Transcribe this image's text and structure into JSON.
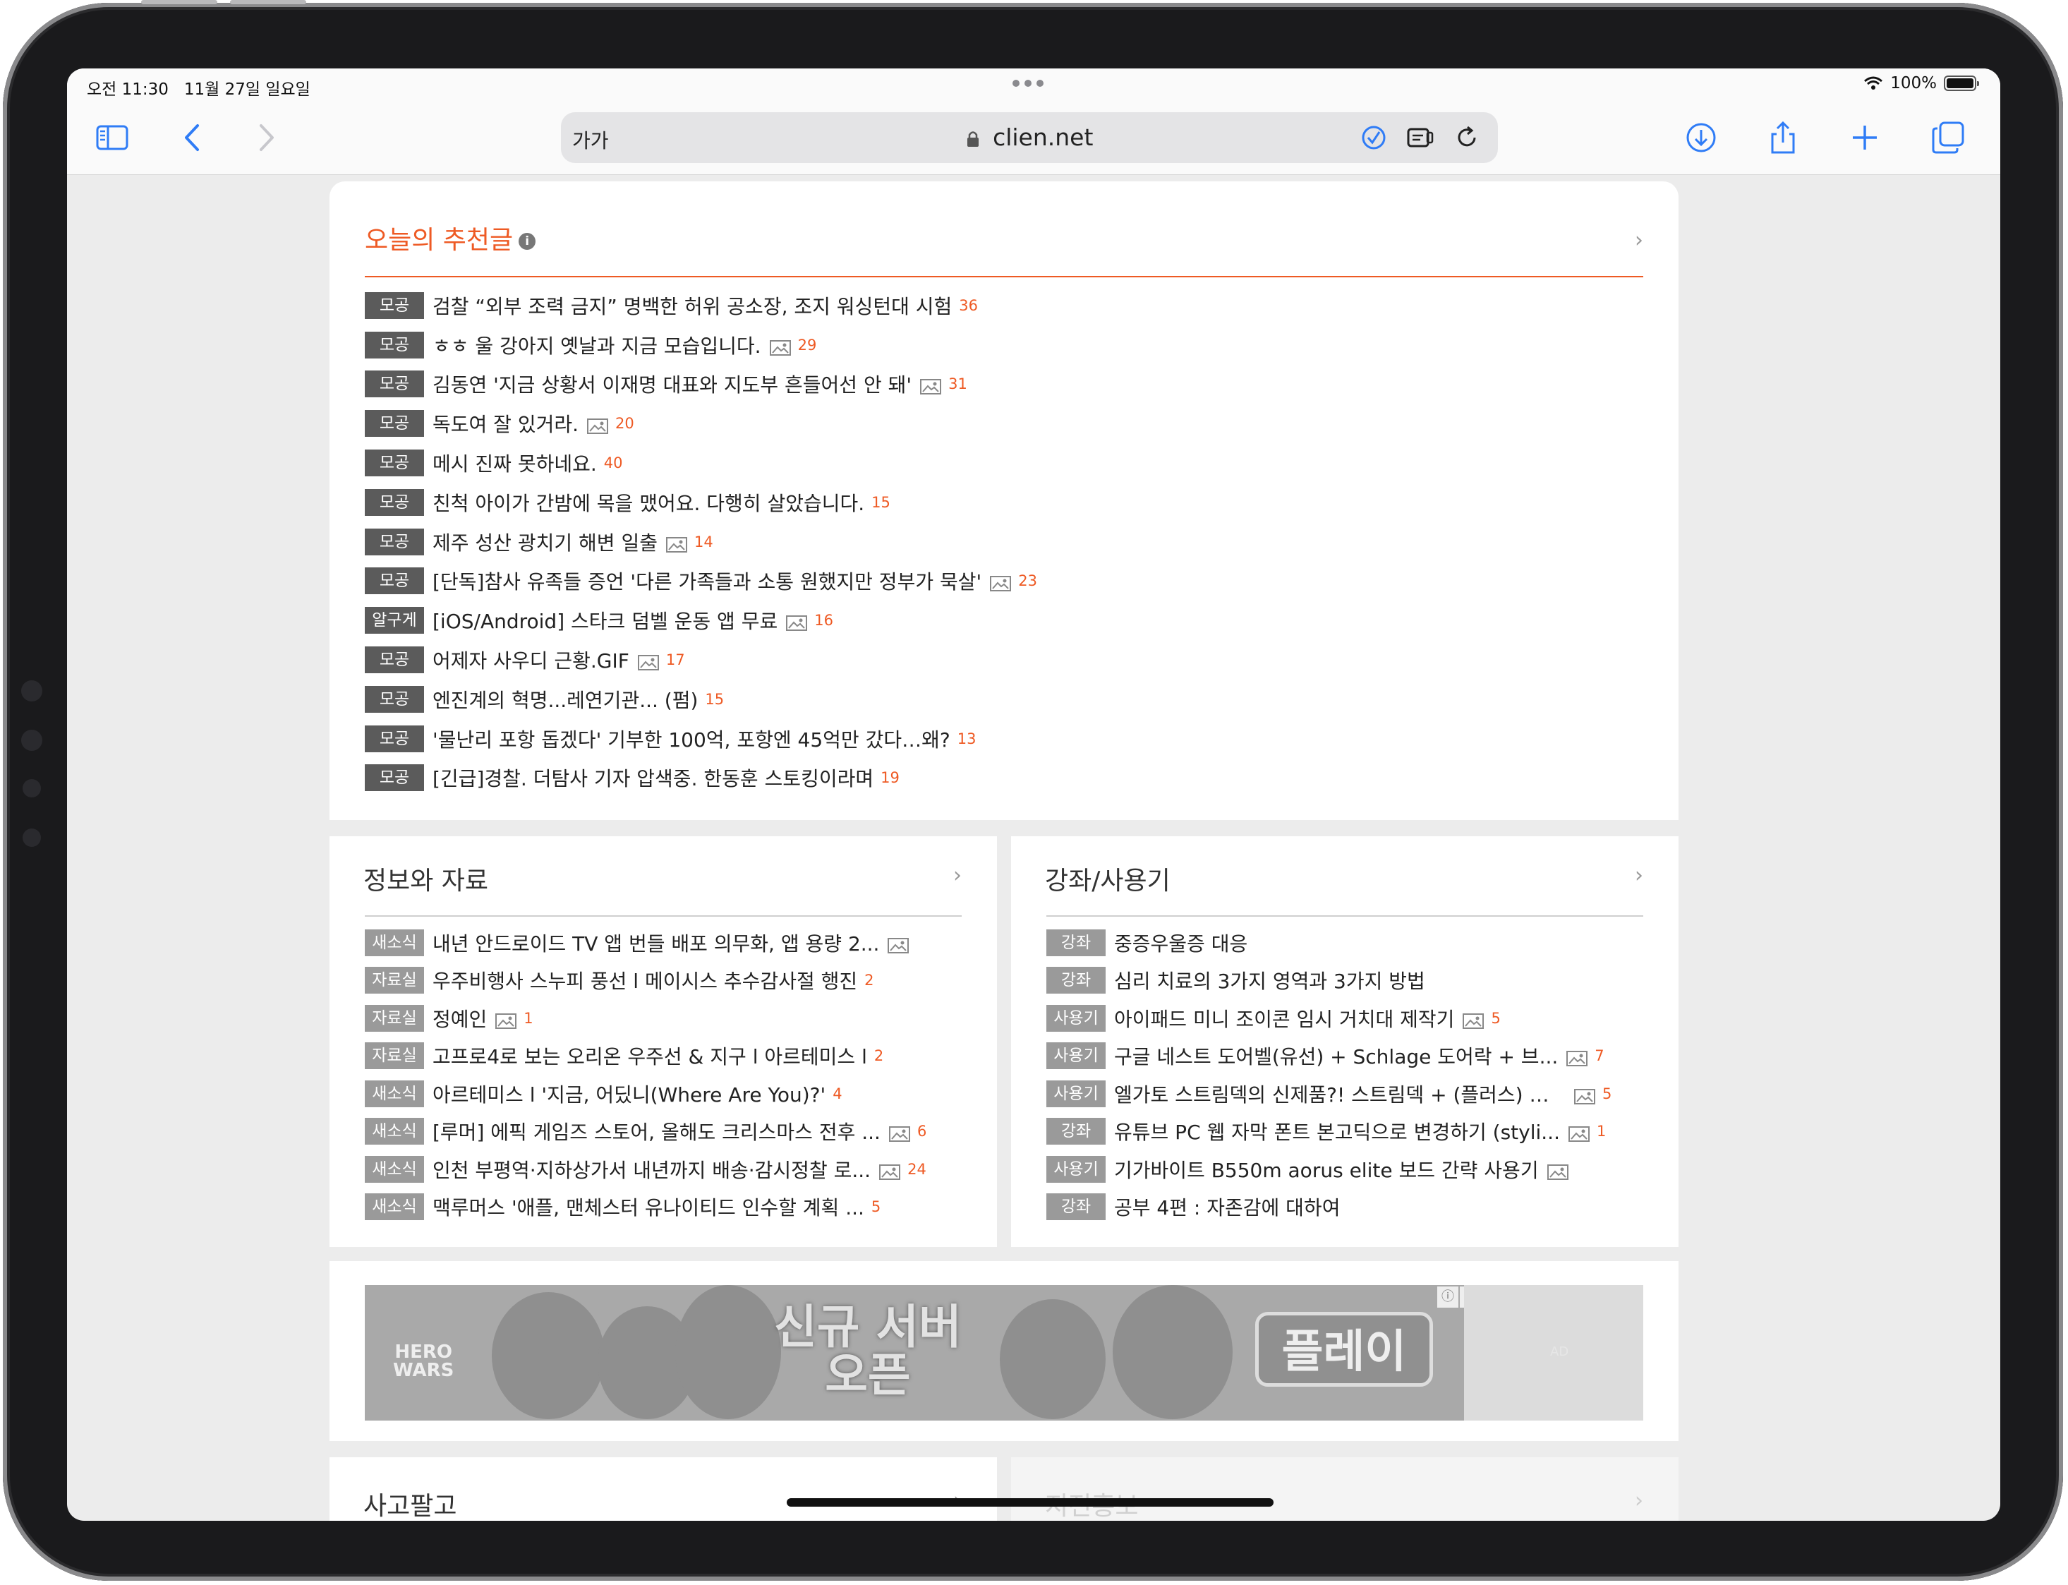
{
  "status_bar": {
    "time": "오전 11:30   11월 27일 일요일",
    "battery": "100%",
    "battery_level": 1.0
  },
  "browser": {
    "text_size_label": "가가",
    "url": "clien.net",
    "icons": [
      "sidebar-icon",
      "back-icon",
      "forward-icon",
      "lock-icon",
      "extension-icon",
      "reader-icon",
      "reload-icon",
      "download-icon",
      "share-icon",
      "new-tab-icon",
      "tabs-icon"
    ]
  },
  "recommended": {
    "title": "오늘의 추천글",
    "items": [
      {
        "tag": "모공",
        "title": "검찰 “외부 조력 금지” 명백한 허위 공소장, 조지 워싱턴대 시험",
        "image": false,
        "count": "36"
      },
      {
        "tag": "모공",
        "title": "ㅎㅎ 울 강아지 옛날과 지금 모습입니다.",
        "image": true,
        "count": "29"
      },
      {
        "tag": "모공",
        "title": "김동연 '지금 상황서 이재명 대표와 지도부 흔들어선 안 돼'",
        "image": true,
        "count": "31"
      },
      {
        "tag": "모공",
        "title": "독도여 잘 있거라.",
        "image": true,
        "count": "20"
      },
      {
        "tag": "모공",
        "title": "메시 진짜 못하네요.",
        "image": false,
        "count": "40"
      },
      {
        "tag": "모공",
        "title": "친척 아이가 간밤에 목을 맸어요. 다행히 살았습니다.",
        "image": false,
        "count": "15"
      },
      {
        "tag": "모공",
        "title": "제주 성산 광치기 해변 일출",
        "image": true,
        "count": "14"
      },
      {
        "tag": "모공",
        "title": "[단독]참사 유족들 증언 '다른 가족들과 소통 원했지만 정부가 묵살'",
        "image": true,
        "count": "23"
      },
      {
        "tag": "알구게",
        "title": "[iOS/Android] 스타크 덤벨 운동 앱 무료",
        "image": true,
        "count": "16"
      },
      {
        "tag": "모공",
        "title": "어제자 사우디 근황.GIF",
        "image": true,
        "count": "17"
      },
      {
        "tag": "모공",
        "title": "엔진계의 혁명...레연기관... (펌)",
        "image": false,
        "count": "15"
      },
      {
        "tag": "모공",
        "title": "'물난리 포항 돕겠다' 기부한 100억, 포항엔 45억만 갔다…왜?",
        "image": false,
        "count": "13"
      },
      {
        "tag": "모공",
        "title": "[긴급]경찰. 더탐사 기자 압색중. 한동훈 스토킹이라며",
        "image": false,
        "count": "19"
      }
    ]
  },
  "info_section": {
    "title": "정보와 자료",
    "items": [
      {
        "tag": "새소식",
        "title": "내년 안드로이드 TV 앱 번들 배포 의무화, 앱 용량 2...",
        "image": true,
        "count": ""
      },
      {
        "tag": "자료실",
        "title": "우주비행사 스누피 풍선 l 메이시스 추수감사절 행진",
        "image": false,
        "count": "2"
      },
      {
        "tag": "자료실",
        "title": "정예인",
        "image": true,
        "count": "1"
      },
      {
        "tag": "자료실",
        "title": "고프로4로 보는 오리온 우주선 & 지구 l 아르테미스 l",
        "image": false,
        "count": "2"
      },
      {
        "tag": "새소식",
        "title": "아르테미스 l '지금, 어딨니(Where Are You)?'",
        "image": false,
        "count": "4"
      },
      {
        "tag": "새소식",
        "title": "[루머] 에픽 게임즈 스토어, 올해도 크리스마스 전후 ...",
        "image": true,
        "count": "6"
      },
      {
        "tag": "새소식",
        "title": "인천 부평역·지하상가서 내년까지 배송·감시정찰 로...",
        "image": true,
        "count": "24"
      },
      {
        "tag": "새소식",
        "title": "맥루머스 '애플, 맨체스터 유나이티드 인수할 계획 ...",
        "image": false,
        "count": "5"
      }
    ]
  },
  "lecture_section": {
    "title": "강좌/사용기",
    "items": [
      {
        "tag": "강좌",
        "title": "중증우울증 대응",
        "image": false,
        "count": ""
      },
      {
        "tag": "강좌",
        "title": "심리 치료의 3가지 영역과 3가지 방법",
        "image": false,
        "count": ""
      },
      {
        "tag": "사용기",
        "title": "아이패드 미니 조이콘 임시 거치대 제작기",
        "image": true,
        "count": "5"
      },
      {
        "tag": "사용기",
        "title": "구글 네스트 도어벨(유선) + Schlage 도어락 + 브...",
        "image": true,
        "count": "7"
      },
      {
        "tag": "사용기",
        "title": "엘가토 스트림덱의 신제품?! 스트림덱 + (플러스) 간...",
        "image": true,
        "count": "5"
      },
      {
        "tag": "강좌",
        "title": "유튜브 PC 웹 자막 폰트 본고딕으로 변경하기 (styli...",
        "image": true,
        "count": "1"
      },
      {
        "tag": "사용기",
        "title": "기가바이트 B550m aorus elite 보드 간략 사용기",
        "image": true,
        "count": ""
      },
      {
        "tag": "강좌",
        "title": "공부 4편 : 자존감에 대하여",
        "image": false,
        "count": ""
      }
    ]
  },
  "ad": {
    "logo": "HERO\nWARS",
    "headline": "신규 서버\n오픈",
    "button": "플레이",
    "label": "AD"
  },
  "bottom": {
    "left_title": "사고팔고",
    "right_title": "지전홍보"
  }
}
